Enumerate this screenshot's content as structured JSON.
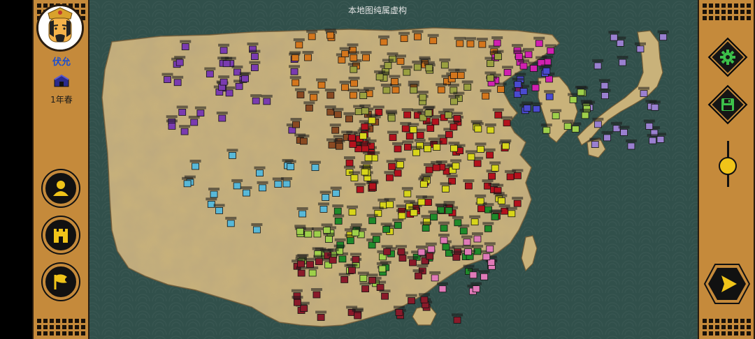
{
  "map": {
    "disclaimer": "本地图纯属虚构",
    "factions": [
      {
        "name": "violet",
        "color": "#7a3bb0"
      },
      {
        "name": "red",
        "color": "#b3121d"
      },
      {
        "name": "yellow",
        "color": "#d8d51a"
      },
      {
        "name": "green",
        "color": "#1f8a2a"
      },
      {
        "name": "lightgreen",
        "color": "#9ed04a"
      },
      {
        "name": "cyan",
        "color": "#58b8d8"
      },
      {
        "name": "orange",
        "color": "#d4761c"
      },
      {
        "name": "brown",
        "color": "#8a4a22"
      },
      {
        "name": "magenta",
        "color": "#d020b0"
      },
      {
        "name": "pink",
        "color": "#e07ab8"
      },
      {
        "name": "maroon",
        "color": "#8a1a2a"
      },
      {
        "name": "olive",
        "color": "#9aa040"
      },
      {
        "name": "lavender",
        "color": "#9a80d0"
      },
      {
        "name": "blue",
        "color": "#4a4ad0"
      }
    ]
  },
  "player": {
    "ruler_name": "伏允",
    "season": "1年春",
    "colors": {
      "avatar_face": "#f4b24a",
      "brand": "#c58a3b",
      "name": "#1a4dd0"
    }
  },
  "left_menu": [
    {
      "icon": "person-icon",
      "label": ""
    },
    {
      "icon": "castle-icon",
      "label": ""
    },
    {
      "icon": "flag-icon",
      "label": ""
    }
  ],
  "right_menu": {
    "settings_icon": "gear-icon",
    "save_icon": "floppy-icon",
    "next_icon": "play-arrow-icon",
    "zoom_level": 0.45
  }
}
